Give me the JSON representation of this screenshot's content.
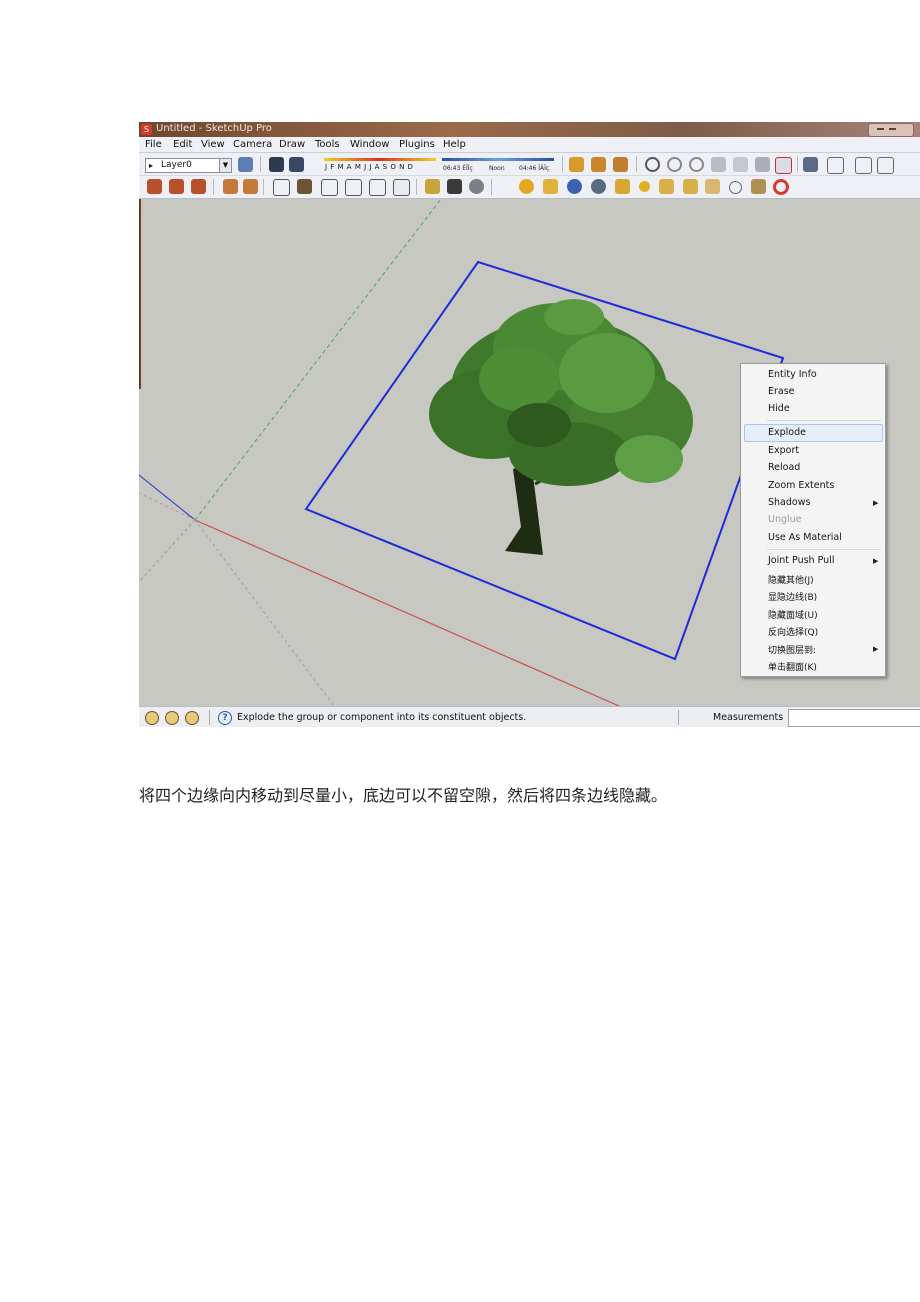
{
  "window": {
    "title": "Untitled - SketchUp Pro"
  },
  "menubar": {
    "items": [
      "File",
      "Edit",
      "View",
      "Camera",
      "Draw",
      "Tools",
      "Window",
      "Plugins",
      "Help"
    ]
  },
  "toolbar": {
    "layer_value": "Layer0",
    "months_label": "J F M A M J J A S O N D",
    "time_start": "06:43 ÈÎÏç",
    "time_noon": "Noon",
    "time_end": "04:46 ÏÂÎç"
  },
  "context_menu": {
    "items": [
      {
        "label": "Entity Info"
      },
      {
        "label": "Erase"
      },
      {
        "label": "Hide"
      },
      {
        "label": "Explode"
      },
      {
        "label": "Export"
      },
      {
        "label": "Reload"
      },
      {
        "label": "Zoom Extents"
      },
      {
        "label": "Shadows"
      },
      {
        "label": "Unglue"
      },
      {
        "label": "Use As Material"
      },
      {
        "label": "Joint Push Pull"
      },
      {
        "label": "隐藏其他(J)"
      },
      {
        "label": "显隐边线(B)"
      },
      {
        "label": "隐藏面域(U)"
      },
      {
        "label": "反向选择(Q)"
      },
      {
        "label": "切换图层到:"
      },
      {
        "label": "单击翻面(K)"
      }
    ],
    "highlighted": "Explode",
    "disabled": [
      "Unglue"
    ],
    "submenus": [
      "Shadows",
      "Joint Push Pull",
      "切换图层到:"
    ]
  },
  "statusbar": {
    "message": "Explode the group or component into its constituent objects.",
    "measurements_label": "Measurements",
    "measurements_value": ""
  },
  "caption": "将四个边缘向内移动到尽量小，底边可以不留空隙，然后将四条边线隐藏。",
  "colors": {
    "selection_box": "#1f2bd8",
    "axis_red": "#c8504a",
    "axis_green": "#4aa84a",
    "axis_blue": "#3b47c8",
    "tree_foliage": "#3f7a2c"
  }
}
